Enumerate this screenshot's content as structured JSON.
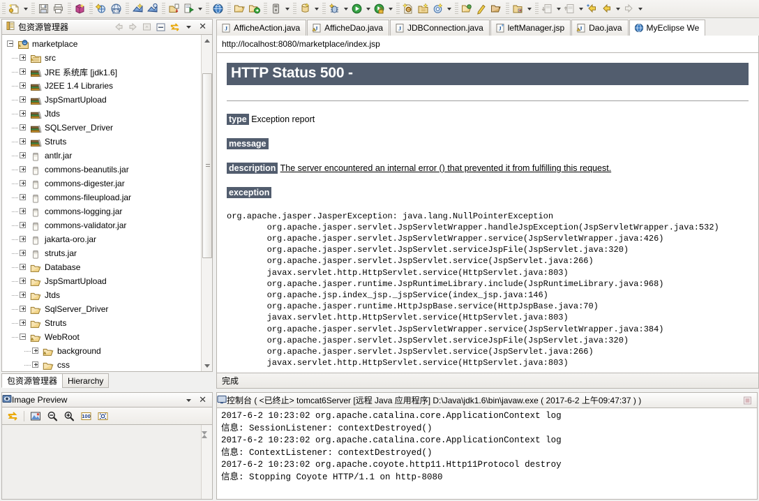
{
  "toolbar": {
    "groups": [
      {
        "items": [
          {
            "icon": "new-wizard-icon",
            "menu": true
          }
        ]
      },
      {
        "items": [
          {
            "icon": "save-icon"
          },
          {
            "icon": "print-icon"
          }
        ]
      },
      {
        "items": [
          {
            "icon": "package-icon"
          }
        ]
      },
      {
        "items": [
          {
            "icon": "build-icon"
          },
          {
            "icon": "web20-icon"
          }
        ]
      },
      {
        "items": [
          {
            "icon": "new-jsp-icon"
          },
          {
            "icon": "new-html-icon"
          }
        ]
      },
      {
        "items": [
          {
            "icon": "import-icon"
          },
          {
            "icon": "export-run-icon",
            "menu": true
          }
        ]
      },
      {
        "items": [
          {
            "icon": "browser-icon"
          }
        ]
      },
      {
        "items": [
          {
            "icon": "open-folder-icon"
          },
          {
            "icon": "deploy-icon"
          }
        ]
      },
      {
        "items": [
          {
            "icon": "server-icon",
            "menu": true
          }
        ]
      },
      {
        "items": [
          {
            "icon": "database-icon",
            "menu": true
          }
        ]
      },
      {
        "items": [
          {
            "icon": "debug-icon",
            "menu": true
          },
          {
            "icon": "run-icon",
            "menu": true
          },
          {
            "icon": "run-secure-icon",
            "menu": true
          }
        ]
      },
      {
        "items": [
          {
            "icon": "new-class-icon"
          },
          {
            "icon": "new-package-icon"
          },
          {
            "icon": "new-interface-icon",
            "menu": true
          }
        ]
      },
      {
        "items": [
          {
            "icon": "open-type-icon"
          },
          {
            "icon": "search-icon"
          },
          {
            "icon": "open-resource-icon"
          }
        ]
      },
      {
        "items": [
          {
            "icon": "folder-link-icon",
            "menu": true
          }
        ]
      },
      {
        "items": [
          {
            "icon": "next-annotation-icon",
            "menu": true
          },
          {
            "icon": "prev-annotation-icon",
            "menu": true
          },
          {
            "icon": "last-edit-icon"
          },
          {
            "icon": "back-icon",
            "menu": true
          },
          {
            "icon": "forward-icon",
            "menu": true
          }
        ]
      }
    ]
  },
  "package_explorer": {
    "title": "包资源管理器",
    "toolbar_buttons": [
      "back-icon",
      "forward-icon",
      "collapse-up-icon",
      "collapse-all-icon",
      "link-editor-icon",
      "view-menu-icon",
      "close-icon"
    ],
    "tree": [
      {
        "label": "marketplace",
        "icon": "java-project-icon",
        "depth": 0,
        "state": "expanded"
      },
      {
        "label": "src",
        "icon": "source-folder-icon",
        "depth": 1,
        "state": "collapsed"
      },
      {
        "label": "JRE 系统库 [jdk1.6]",
        "icon": "library-icon",
        "depth": 1,
        "state": "collapsed"
      },
      {
        "label": "J2EE 1.4 Libraries",
        "icon": "library-icon",
        "depth": 1,
        "state": "collapsed"
      },
      {
        "label": "JspSmartUpload",
        "icon": "library-icon",
        "depth": 1,
        "state": "collapsed"
      },
      {
        "label": "Jtds",
        "icon": "library-icon",
        "depth": 1,
        "state": "collapsed"
      },
      {
        "label": "SQLServer_Driver",
        "icon": "library-icon",
        "depth": 1,
        "state": "collapsed"
      },
      {
        "label": "Struts",
        "icon": "library-icon",
        "depth": 1,
        "state": "collapsed"
      },
      {
        "label": "antlr.jar",
        "icon": "jar-icon",
        "depth": 1,
        "state": "collapsed"
      },
      {
        "label": "commons-beanutils.jar",
        "icon": "jar-icon",
        "depth": 1,
        "state": "collapsed"
      },
      {
        "label": "commons-digester.jar",
        "icon": "jar-icon",
        "depth": 1,
        "state": "collapsed"
      },
      {
        "label": "commons-fileupload.jar",
        "icon": "jar-icon",
        "depth": 1,
        "state": "collapsed"
      },
      {
        "label": "commons-logging.jar",
        "icon": "jar-icon",
        "depth": 1,
        "state": "collapsed"
      },
      {
        "label": "commons-validator.jar",
        "icon": "jar-icon",
        "depth": 1,
        "state": "collapsed"
      },
      {
        "label": "jakarta-oro.jar",
        "icon": "jar-icon",
        "depth": 1,
        "state": "collapsed"
      },
      {
        "label": "struts.jar",
        "icon": "jar-icon",
        "depth": 1,
        "state": "collapsed"
      },
      {
        "label": "Database",
        "icon": "folder-icon",
        "depth": 1,
        "state": "collapsed"
      },
      {
        "label": "JspSmartUpload",
        "icon": "folder-icon",
        "depth": 1,
        "state": "collapsed"
      },
      {
        "label": "Jtds",
        "icon": "folder-icon",
        "depth": 1,
        "state": "collapsed"
      },
      {
        "label": "SqlServer_Driver",
        "icon": "folder-icon",
        "depth": 1,
        "state": "collapsed"
      },
      {
        "label": "Struts",
        "icon": "folder-icon",
        "depth": 1,
        "state": "collapsed"
      },
      {
        "label": "WebRoot",
        "icon": "folder-warning-icon",
        "depth": 1,
        "state": "expanded"
      },
      {
        "label": "background",
        "icon": "folder-warning-icon",
        "depth": 2,
        "state": "collapsed"
      },
      {
        "label": "css",
        "icon": "folder-icon",
        "depth": 2,
        "state": "collapsed"
      }
    ],
    "bottom_tabs": [
      {
        "label": "包资源管理器",
        "selected": true
      },
      {
        "label": "Hierarchy",
        "selected": false
      }
    ]
  },
  "image_preview": {
    "title": "Image Preview",
    "icon": "image-preview-icon",
    "toolbar_buttons": [
      "link-editor-icon",
      "preview-image-icon",
      "zoom-out-icon",
      "zoom-in-icon",
      "zoom-100-icon",
      "zoom-fit-icon"
    ],
    "view_menu_icon": "chevron-down-icon",
    "close_icon": "close-icon"
  },
  "editor": {
    "tabs": [
      {
        "label": "AfficheAction.java",
        "icon": "java-file-icon",
        "selected": false
      },
      {
        "label": "AfficheDao.java",
        "icon": "java-file-warning-icon",
        "selected": false
      },
      {
        "label": "JDBConnection.java",
        "icon": "java-file-icon",
        "selected": false
      },
      {
        "label": "leftManager.jsp",
        "icon": "jsp-file-icon",
        "selected": false
      },
      {
        "label": "Dao.java",
        "icon": "java-file-warning-icon",
        "selected": false
      },
      {
        "label": "MyEclipse We",
        "icon": "browser-icon",
        "selected": true
      }
    ],
    "url": "http://localhost:8080/marketplace/index.jsp",
    "status": "完成"
  },
  "error_page": {
    "header_bg": "#525d6e",
    "title": "HTTP Status 500 - ",
    "rows": [
      {
        "tag": "type",
        "text": "Exception report",
        "underline": false
      },
      {
        "tag": "message",
        "text": "",
        "underline": false
      },
      {
        "tag": "description",
        "text": "The server encountered an internal error () that prevented it from fulfilling this request.",
        "underline": true
      },
      {
        "tag": "exception",
        "text": "",
        "underline": false
      }
    ],
    "stack_trace": "org.apache.jasper.JasperException: java.lang.NullPointerException\n        org.apache.jasper.servlet.JspServletWrapper.handleJspException(JspServletWrapper.java:532)\n        org.apache.jasper.servlet.JspServletWrapper.service(JspServletWrapper.java:426)\n        org.apache.jasper.servlet.JspServlet.serviceJspFile(JspServlet.java:320)\n        org.apache.jasper.servlet.JspServlet.service(JspServlet.java:266)\n        javax.servlet.http.HttpServlet.service(HttpServlet.java:803)\n        org.apache.jasper.runtime.JspRuntimeLibrary.include(JspRuntimeLibrary.java:968)\n        org.apache.jsp.index_jsp._jspService(index_jsp.java:146)\n        org.apache.jasper.runtime.HttpJspBase.service(HttpJspBase.java:70)\n        javax.servlet.http.HttpServlet.service(HttpServlet.java:803)\n        org.apache.jasper.servlet.JspServletWrapper.service(JspServletWrapper.java:384)\n        org.apache.jasper.servlet.JspServlet.serviceJspFile(JspServlet.java:320)\n        org.apache.jasper.servlet.JspServlet.service(JspServlet.java:266)\n        javax.servlet.http.HttpServlet.service(HttpServlet.java:803)"
  },
  "console": {
    "icon": "console-icon",
    "title": "控制台 ( <已终止> tomcat6Server [远程 Java 应用程序] D:\\Java\\jdk1.6\\bin\\javaw.exe ( 2017-6-2 上午09:47:37 ) )",
    "stop_icon": "terminate-icon",
    "output": "2017-6-2 10:23:02 org.apache.catalina.core.ApplicationContext log\n信息: SessionListener: contextDestroyed()\n2017-6-2 10:23:02 org.apache.catalina.core.ApplicationContext log\n信息: ContextListener: contextDestroyed()\n2017-6-2 10:23:02 org.apache.coyote.http11.Http11Protocol destroy\n信息: Stopping Coyote HTTP/1.1 on http-8080"
  }
}
